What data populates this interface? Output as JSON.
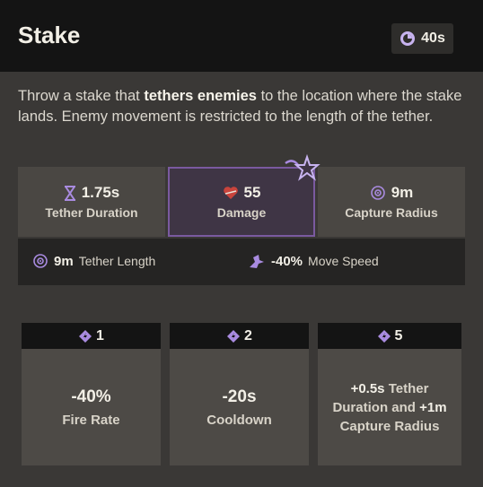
{
  "ability": {
    "title": "Stake",
    "cooldown": "40s"
  },
  "description": {
    "before": "Throw a stake that ",
    "highlight": "tethers enemies",
    "after": " to the location where the stake lands. Enemy movement is restricted to the length of the tether."
  },
  "stats": [
    {
      "value": "1.75s",
      "label": "Tether Duration",
      "icon": "hourglass-icon"
    },
    {
      "value": "55",
      "label": "Damage",
      "icon": "heart-damage-icon"
    },
    {
      "value": "9m",
      "label": "Capture Radius",
      "icon": "target-icon"
    }
  ],
  "substats": [
    {
      "value": "9m",
      "label": "Tether Length",
      "icon": "target-icon"
    },
    {
      "value": "-40%",
      "label": "Move Speed",
      "icon": "slow-icon"
    }
  ],
  "upgrades": [
    {
      "cost": "1",
      "value": "-40%",
      "label": "Fire Rate"
    },
    {
      "cost": "2",
      "value": "-20s",
      "label": "Cooldown"
    },
    {
      "cost": "5",
      "value_1": "+0.5s",
      "text_1": " Tether Duration and ",
      "value_2": "+1m",
      "text_2": " Capture Radius"
    }
  ],
  "colors": {
    "accent_purple": "#a98be0",
    "header_bg": "#141414",
    "panel_bg": "#4a4743",
    "damage_red": "#c9443c"
  }
}
